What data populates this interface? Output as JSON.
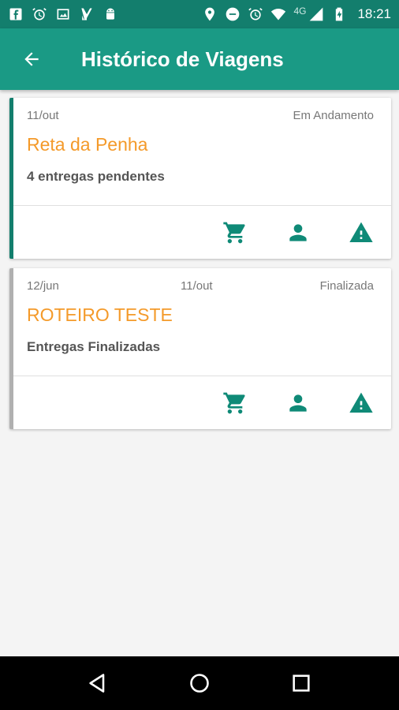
{
  "status_bar": {
    "time": "18:21",
    "network": "4G",
    "left_icons": [
      "facebook-icon",
      "alarm-icon",
      "image-icon",
      "app-icon",
      "android-icon"
    ],
    "right_icons": [
      "location-icon",
      "do-not-disturb-icon",
      "alarm-icon",
      "wifi-icon",
      "signal-icon",
      "battery-icon"
    ]
  },
  "app_bar": {
    "title": "Histórico de Viagens",
    "back_icon": "arrow-back-icon",
    "color": "#1a9a85"
  },
  "trips": [
    {
      "date_start": "11/out",
      "date_end": "",
      "status": "Em Andamento",
      "route": "Reta da Penha",
      "detail": "4 entregas pendentes",
      "accent": "#137e6d",
      "actions": [
        "cart-icon",
        "person-icon",
        "warning-icon"
      ]
    },
    {
      "date_start": "12/jun",
      "date_end": "11/out",
      "status": "Finalizada",
      "route": "ROTEIRO TESTE",
      "detail": "Entregas Finalizadas",
      "accent": "#b0b0b0",
      "actions": [
        "cart-icon",
        "person-icon",
        "warning-icon"
      ]
    }
  ],
  "nav_bar": {
    "buttons": [
      "back-triangle-icon",
      "home-circle-icon",
      "recents-square-icon"
    ]
  }
}
